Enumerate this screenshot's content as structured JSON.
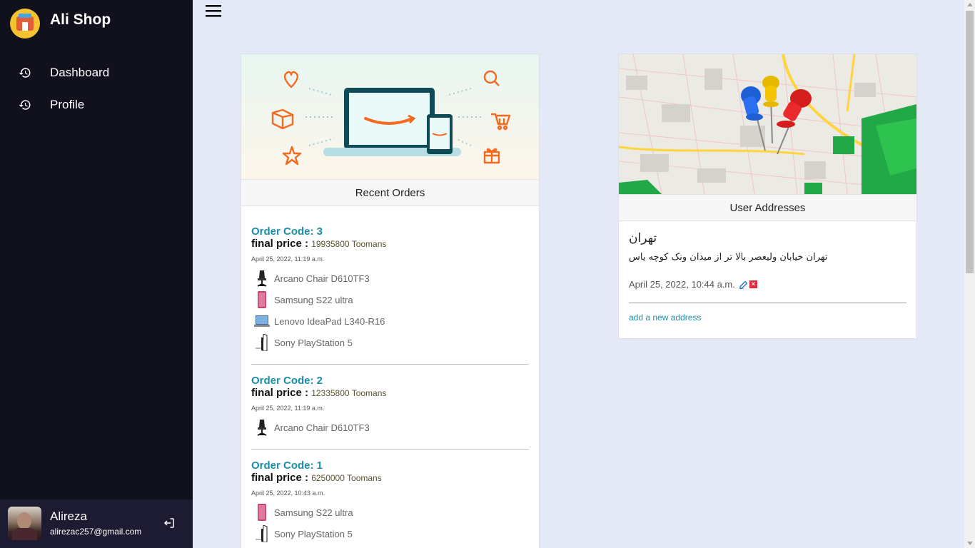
{
  "sidebar": {
    "shop_name": "Ali Shop",
    "nav": [
      {
        "label": "Dashboard",
        "icon": "history-icon"
      },
      {
        "label": "Profile",
        "icon": "history-icon"
      }
    ],
    "user": {
      "name": "Alireza",
      "email": "alirezac257@gmail.com"
    }
  },
  "orders": {
    "header": "Recent Orders",
    "list": [
      {
        "code": "Order Code: 3",
        "price_label": "final price : ",
        "price_value": "19935800 Toomans",
        "date": "April 25, 2022, 11:19 a.m.",
        "items": [
          "Arcano Chair D610TF3",
          "Samsung S22 ultra",
          "Lenovo IdeaPad L340-R16",
          "Sony PlayStation 5"
        ]
      },
      {
        "code": "Order Code: 2",
        "price_label": "final price : ",
        "price_value": "12335800 Toomans",
        "date": "April 25, 2022, 11:19 a.m.",
        "items": [
          "Arcano Chair D610TF3"
        ]
      },
      {
        "code": "Order Code: 1",
        "price_label": "final price : ",
        "price_value": "6250000 Toomans",
        "date": "April 25, 2022, 10:43 a.m.",
        "items": [
          "Samsung S22 ultra",
          "Sony PlayStation 5"
        ]
      }
    ]
  },
  "addresses": {
    "header": "User Addresses",
    "title": "تهران",
    "text": "تهران خیابان ولیعصر بالا تر از میدان ونک کوچه یاس",
    "date": "April 25, 2022, 10:44 a.m.",
    "add_link": "add a new address"
  },
  "colors": {
    "accent": "#1a8fa8",
    "sidebar": "#11101d",
    "background": "#e4e9f7",
    "banner_icons": "#f26b21"
  }
}
